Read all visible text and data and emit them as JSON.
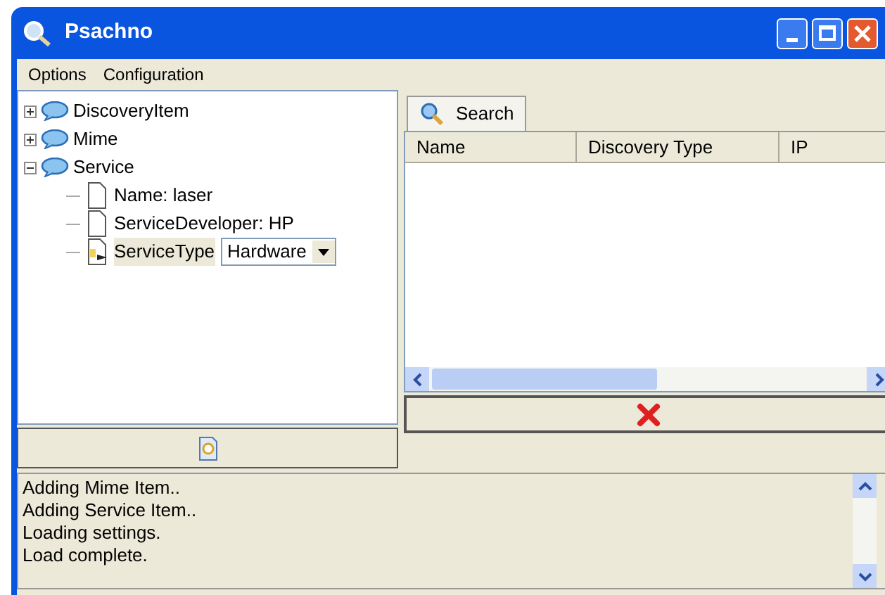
{
  "window": {
    "title": "Psachno"
  },
  "menu": [
    "Options",
    "Configuration"
  ],
  "tree": [
    {
      "label": "DiscoveryItem",
      "expanded": false,
      "selected": false
    },
    {
      "label": "Mime",
      "expanded": false,
      "selected": false
    },
    {
      "label": "Service",
      "expanded": true,
      "selected": false,
      "children": [
        {
          "kind": "text",
          "label": "Name: laser",
          "selected": false
        },
        {
          "kind": "text",
          "label": "ServiceDeveloper: HP",
          "selected": false
        },
        {
          "kind": "select",
          "label": "ServiceType",
          "value": "Hardware",
          "selected": true
        }
      ]
    }
  ],
  "tabs": [
    {
      "label": "Search",
      "selected": true
    }
  ],
  "table": {
    "columns": [
      "Name",
      "Discovery Type",
      "IP"
    ]
  },
  "log": [
    "Adding Mime Item..",
    "Adding Service Item..",
    "Loading settings.",
    "Load complete."
  ]
}
